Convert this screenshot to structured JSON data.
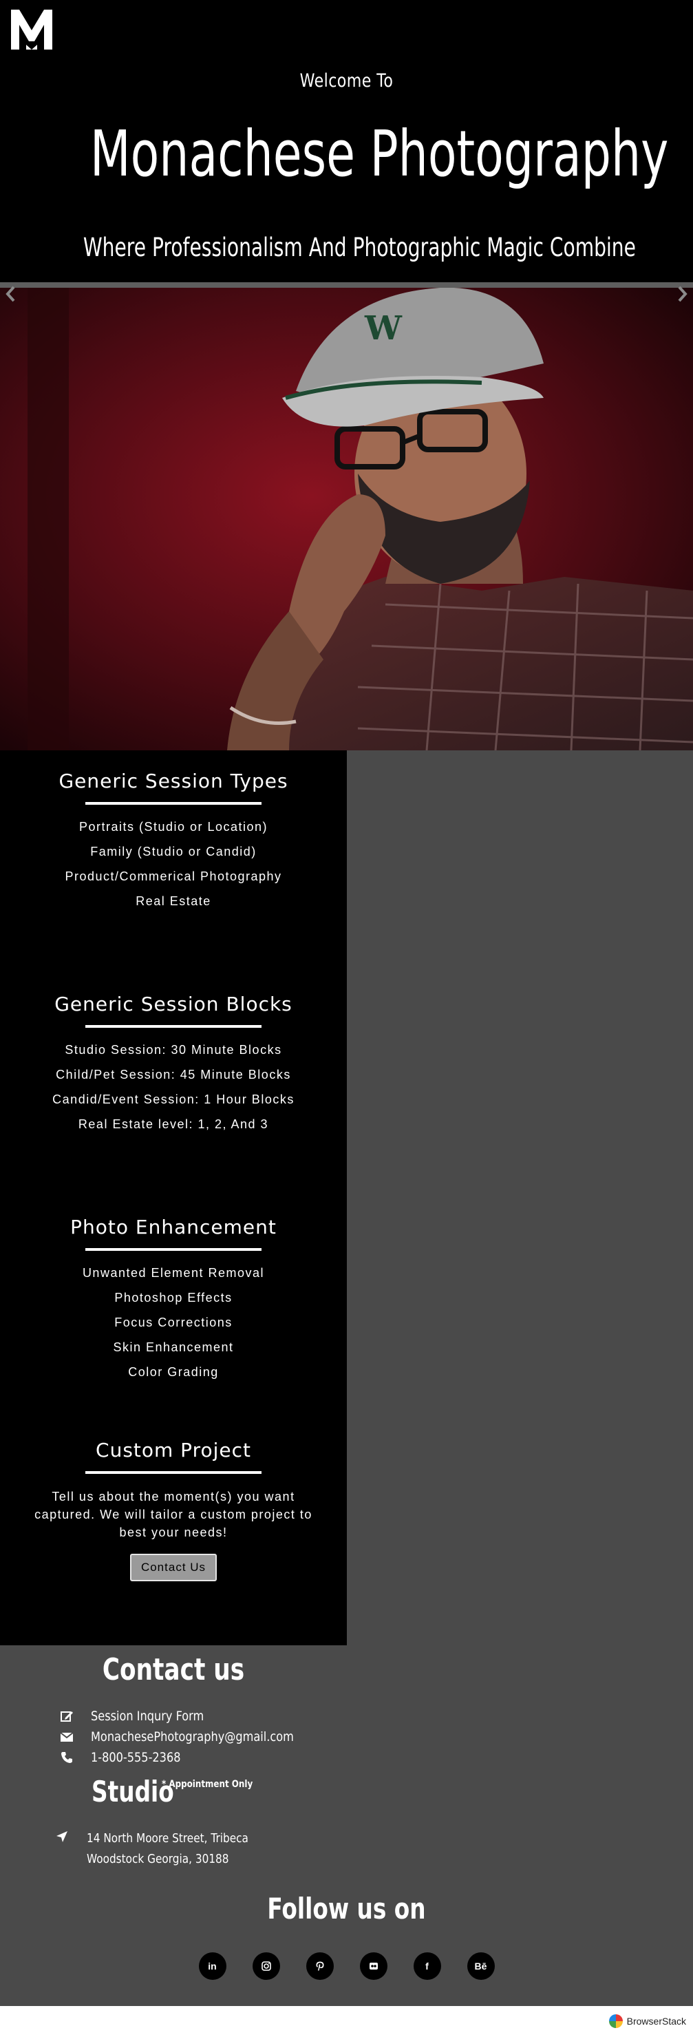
{
  "header": {
    "welcome": "Welcome To",
    "title": "Monachese Photography",
    "tagline": "Where Professionalism And Photographic Magic Combine",
    "logo_icon": "m-logo-icon"
  },
  "carousel": {
    "prev_icon": "chevron-left-icon",
    "next_icon": "chevron-right-icon"
  },
  "services": [
    {
      "title": "Generic Session Types",
      "items": [
        "Portraits (Studio or Location)",
        "Family (Studio or Candid)",
        "Product/Commerical Photography",
        "Real Estate"
      ]
    },
    {
      "title": "Generic Session Blocks",
      "items": [
        "Studio Session: 30 Minute Blocks",
        "Child/Pet Session: 45 Minute Blocks",
        "Candid/Event Session: 1 Hour Blocks",
        "Real Estate level: 1, 2, And 3"
      ]
    },
    {
      "title": "Photo Enhancement",
      "items": [
        "Unwanted Element Removal",
        "Photoshop Effects",
        "Focus Corrections",
        "Skin Enhancement",
        "Color Grading"
      ]
    },
    {
      "title": "Custom Project",
      "text": "Tell us about the moment(s) you want captured. We will tailor a custom project to best your needs!",
      "button": "Contact Us"
    }
  ],
  "contact": {
    "title": "Contact us",
    "form_label": "Session Inqury Form",
    "email": "MonachesePhotography@gmail.com",
    "phone": "1-800-555-2368",
    "studio_title": "Studio",
    "studio_note": "* Appointment Only",
    "address_line1": "14 North Moore Street, Tribeca",
    "address_line2": "Woodstock Georgia, 30188"
  },
  "follow": {
    "title": "Follow us on",
    "socials": [
      {
        "icon": "linkedin-icon",
        "glyph": "in"
      },
      {
        "icon": "instagram-icon",
        "glyph": ""
      },
      {
        "icon": "pinterest-icon",
        "glyph": ""
      },
      {
        "icon": "flickr-icon",
        "glyph": ""
      },
      {
        "icon": "facebook-icon",
        "glyph": "f"
      },
      {
        "icon": "behance-icon",
        "glyph": "Bē"
      }
    ]
  },
  "bottombar": {
    "brand": "BrowserStack"
  },
  "colors": {
    "background": "#000000",
    "panel": "#4a4a4a",
    "text": "#ffffff",
    "button": "#9a9a9a"
  }
}
